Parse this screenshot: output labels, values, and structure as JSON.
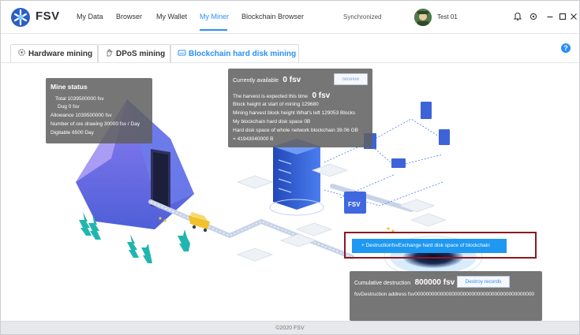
{
  "app": {
    "name": "FSV"
  },
  "nav": {
    "items": [
      {
        "label": "My Data"
      },
      {
        "label": "Browser"
      },
      {
        "label": "My Wallet"
      },
      {
        "label": "My Miner"
      },
      {
        "label": "Blockchain Browser"
      }
    ],
    "active_index": 3
  },
  "status": {
    "sync": "Synchronized"
  },
  "user": {
    "name": "Test 01"
  },
  "tabs": [
    {
      "label": "Hardware mining",
      "icon": "gear-icon"
    },
    {
      "label": "DPoS mining",
      "icon": "hand-icon"
    },
    {
      "label": "Blockchain hard disk mining",
      "icon": "hard-disk-icon"
    }
  ],
  "active_tab": 2,
  "mine_status": {
    "title": "Mine status",
    "total": "Total   1039500000 fsv",
    "dug": "Dug   0 fsv",
    "allowance": "Allowance   1039500000 fsv",
    "ore_drawing": "Number of ore drawing   30000 fsv / Day",
    "digitable": "Digitable   6500 Day"
  },
  "availability": {
    "label": "Currently available",
    "value": "0 fsv",
    "receive_label": "receive",
    "harvest_label": "The harvest is expected this time",
    "harvest_value": "0 fsv",
    "block_start": "Block height at start of mining   129680",
    "harvest_block": "Mining harvest block height   What's left 129053 Blocks",
    "my_space": "My blockchain hard disk space   0B",
    "network_space": "Hard disk space of whole network blockchain   39.06 GB",
    "network_bytes": "= 41943040000 B"
  },
  "destruction": {
    "label": "Cumulative destruction",
    "value": "800000 fsv",
    "records_label": "Destroy records",
    "address": "fsvDestruction address   fsv000000000000000000000000000000000000000000",
    "action_label": "DestructionfsvExchange hard disk space of blockchain"
  },
  "footer": {
    "copyright": "©2020 FSV"
  },
  "colors": {
    "accent": "#2a8ff7",
    "panel": "#606060",
    "highlight": "#8b1a22",
    "button": "#1e98f0"
  }
}
